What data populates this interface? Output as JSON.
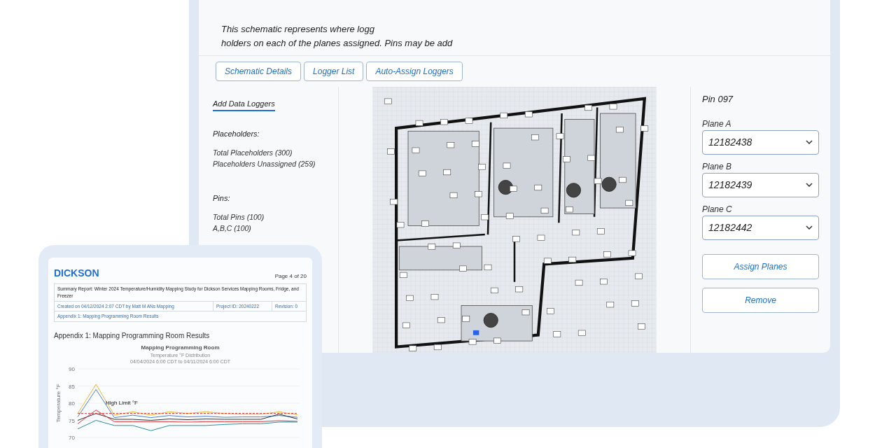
{
  "intro": {
    "lines": [
      "This schematic represents where logg",
      "holders on each of the planes assigned. Pins may be add"
    ]
  },
  "tabs": [
    "Schematic Details",
    "Logger List",
    "Auto-Assign Loggers"
  ],
  "left_panel": {
    "link": "Add Data Loggers",
    "sections": [
      {
        "heading": "Placeholders:",
        "items": [
          "Total Placeholders (300)",
          "Placeholders Unassigned (259)"
        ]
      },
      {
        "heading": "Pins:",
        "items": [
          "Total Pins (100)",
          "A,B,C (100)"
        ]
      }
    ]
  },
  "pin_panel": {
    "title": "Pin 097",
    "planes": [
      {
        "label": "Plane A",
        "value": "12182438"
      },
      {
        "label": "Plane B",
        "value": "12182439"
      },
      {
        "label": "Plane C",
        "value": "12182442"
      }
    ],
    "buttons": [
      "Assign Planes",
      "Remove"
    ]
  },
  "report": {
    "logo": "DICKSON",
    "page": "Page 4 of 20",
    "summary": "Summary Report: Winter 2024 Temperature/Humidity Mapping Study for Dickson Services Mapping Rooms, Fridge, and Freezer",
    "created": "Created on 04/12/2024 2:07 CDT by Matt M ANs Mapping",
    "project": "Project ID: 20240222",
    "revision": "Revision: 0",
    "appendix": "Appendix 1: Mapping Programming Room Results",
    "heading": "Appendix 1: Mapping Programming Room Results",
    "chart_subtitle": "Temperature °F Distribution",
    "chart_range": "04/04/2024 6:00 CDT to 04/11/2024 6:00 CDT",
    "chart_data": {
      "type": "line",
      "title": "Mapping Programming Room",
      "ylabel": "Temperature °F",
      "ylim": [
        70,
        90
      ],
      "yticks": [
        70,
        75,
        80,
        85,
        90
      ],
      "grid": true,
      "series": [
        {
          "color": "#e8b92f",
          "values": [
            77,
            85.5,
            76.5,
            77.5,
            76.5,
            77.5,
            77,
            77.5,
            77,
            76.8,
            76.8,
            77.5,
            76.6
          ]
        },
        {
          "color": "#4a7fd0",
          "values": [
            76,
            84,
            75.8,
            76.5,
            75.8,
            76.4,
            76,
            76.2,
            75.9,
            76,
            76,
            76.4,
            75.9
          ]
        },
        {
          "color": "#333333",
          "values": [
            75,
            77,
            75.3,
            75.3,
            75,
            75.4,
            75.2,
            75.4,
            75.3,
            75.3,
            75.3,
            76.8,
            75.4
          ]
        },
        {
          "color": "#e03c3c",
          "values": [
            74,
            78,
            74.6,
            74.6,
            74.6,
            74.6,
            74.5,
            74.6,
            74.6,
            74.6,
            74.6,
            74.9,
            74.7
          ]
        },
        {
          "color": "#2a8fa0",
          "values": [
            72.5,
            75,
            73.5,
            73.5,
            72,
            73.5,
            73.5,
            73.5,
            73.8,
            74,
            74,
            74.5,
            74.5
          ]
        },
        {
          "name": "High Limit °F",
          "color": "#dc2626",
          "line_style": "dashed",
          "values": [
            77,
            77,
            77,
            77,
            77,
            77,
            77,
            77,
            77,
            77,
            77,
            77,
            77
          ]
        }
      ]
    }
  }
}
